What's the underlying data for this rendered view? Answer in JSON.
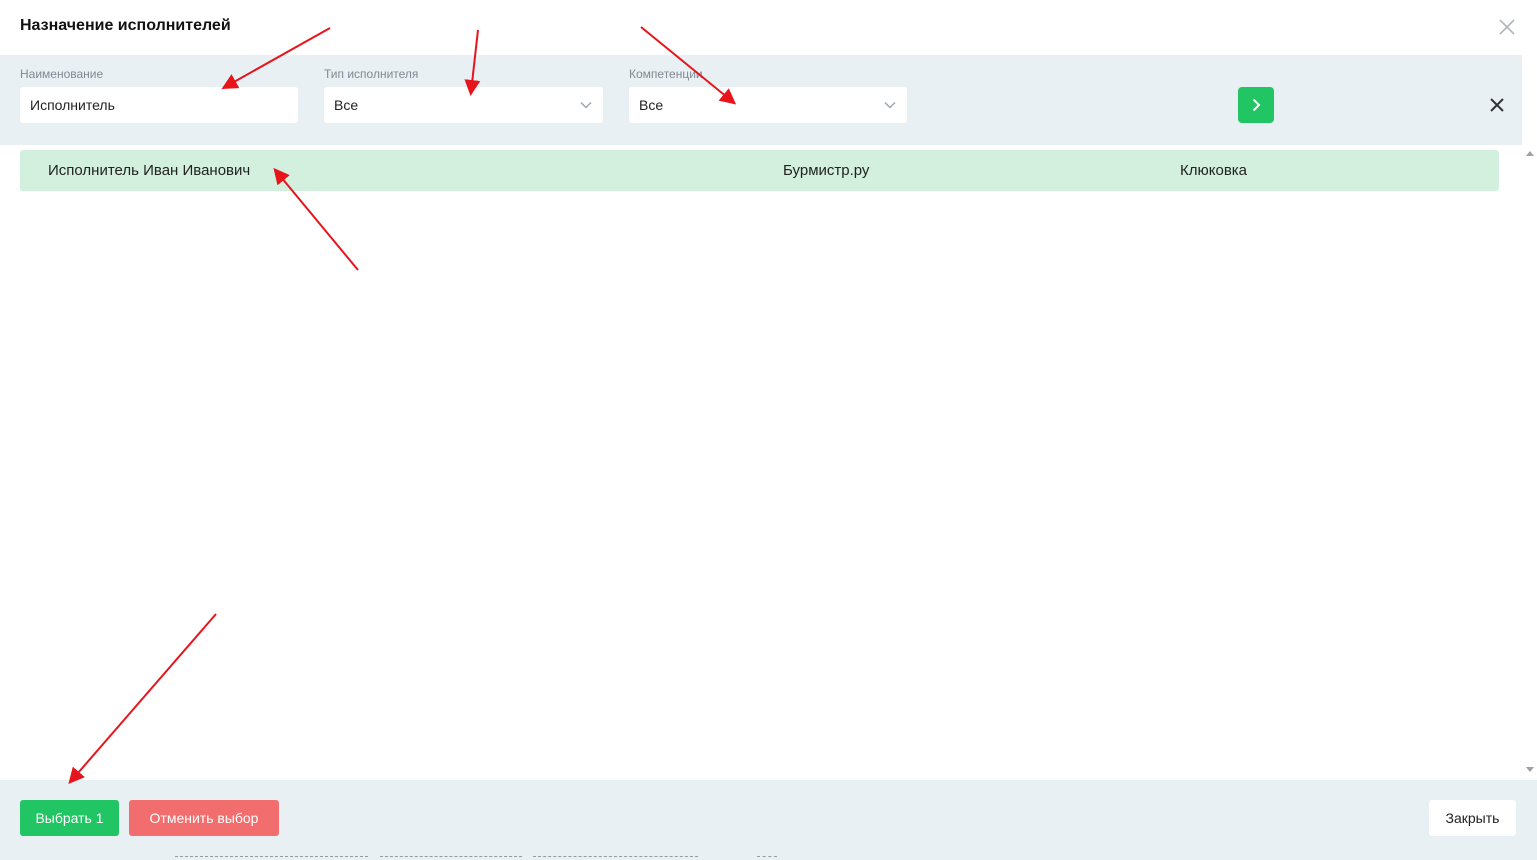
{
  "dialog": {
    "title": "Назначение исполнителей"
  },
  "filters": {
    "name": {
      "label": "Наименование",
      "value": "Исполнитель"
    },
    "executor_type": {
      "label": "Тип исполнителя",
      "value": "Все"
    },
    "competencies": {
      "label": "Компетенции",
      "value": "Все"
    }
  },
  "results": [
    {
      "name": "Исполнитель Иван Иванович",
      "organization": "Бурмистр.ру",
      "address": "Клюковка",
      "selected": true
    }
  ],
  "footer": {
    "select_label": "Выбрать 1",
    "cancel_label": "Отменить выбор",
    "close_label": "Закрыть"
  },
  "colors": {
    "accent_green": "#22c563",
    "danger_red": "#f26d6d",
    "selected_row": "#d3f0df",
    "panel_bg": "#e9f0f3",
    "annotation_arrow": "#e8141b"
  },
  "icons": {
    "close": "close-icon",
    "chevron": "chevron-down-icon",
    "apply": "chevron-right-icon",
    "clear": "clear-filters-icon"
  }
}
